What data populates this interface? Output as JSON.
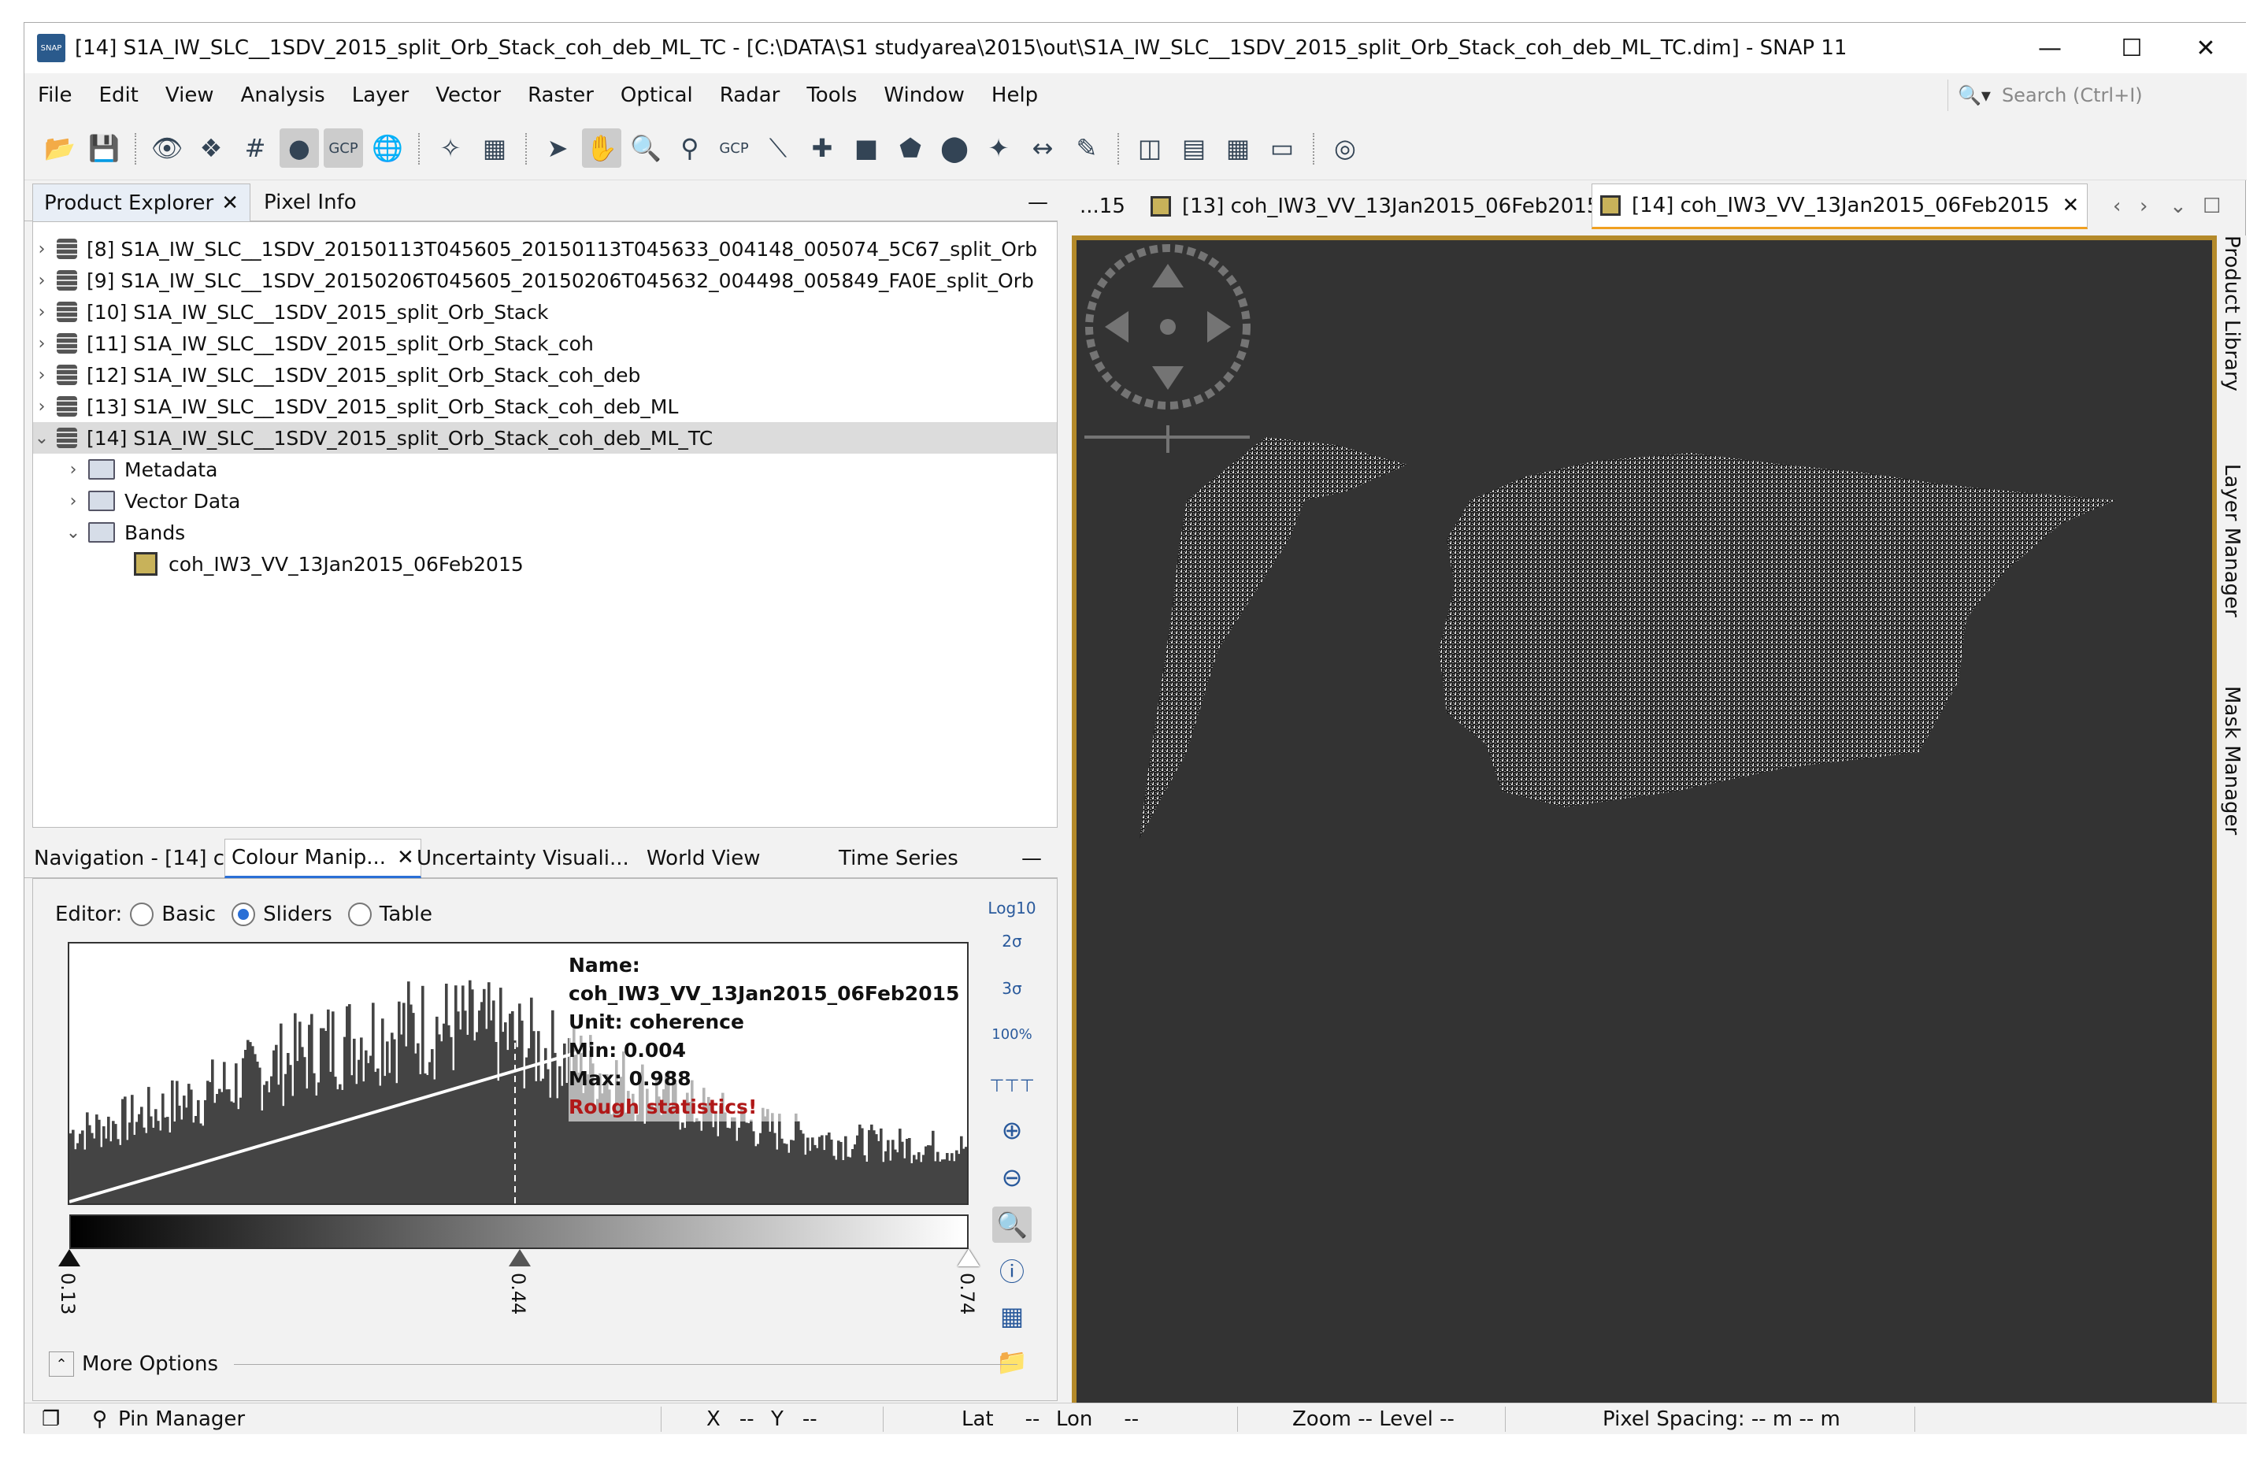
{
  "window": {
    "title": "[14] S1A_IW_SLC__1SDV_2015_split_Orb_Stack_coh_deb_ML_TC - [C:\\DATA\\S1 studyarea\\2015\\out\\S1A_IW_SLC__1SDV_2015_split_Orb_Stack_coh_deb_ML_TC.dim] - SNAP 11",
    "app_icon": "SNAP"
  },
  "menu": [
    "File",
    "Edit",
    "View",
    "Analysis",
    "Layer",
    "Vector",
    "Raster",
    "Optical",
    "Radar",
    "Tools",
    "Window",
    "Help"
  ],
  "search": {
    "placeholder": "Search (Ctrl+I)"
  },
  "left_tabs": {
    "product_explorer": "Product Explorer",
    "pixel_info": "Pixel Info"
  },
  "tree": [
    {
      "label": "[8] S1A_IW_SLC__1SDV_20150113T045605_20150113T045633_004148_005074_5C67_split_Orb"
    },
    {
      "label": "[9] S1A_IW_SLC__1SDV_20150206T045605_20150206T045632_004498_005849_FA0E_split_Orb"
    },
    {
      "label": "[10] S1A_IW_SLC__1SDV_2015_split_Orb_Stack"
    },
    {
      "label": "[11] S1A_IW_SLC__1SDV_2015_split_Orb_Stack_coh"
    },
    {
      "label": "[12] S1A_IW_SLC__1SDV_2015_split_Orb_Stack_coh_deb"
    },
    {
      "label": "[13] S1A_IW_SLC__1SDV_2015_split_Orb_Stack_coh_deb_ML"
    },
    {
      "label": "[14] S1A_IW_SLC__1SDV_2015_split_Orb_Stack_coh_deb_ML_TC"
    }
  ],
  "subtree": {
    "metadata": "Metadata",
    "vector": "Vector Data",
    "bands": "Bands",
    "band": "coh_IW3_VV_13Jan2015_06Feb2015"
  },
  "bottom_tabs": {
    "navigation": "Navigation - [14] c...",
    "colour": "Colour Manip...",
    "uncertainty": "Uncertainty Visuali...",
    "world": "World View",
    "time": "Time Series"
  },
  "editor": {
    "label": "Editor:",
    "basic": "Basic",
    "sliders": "Sliders",
    "table": "Table",
    "selected": "Sliders"
  },
  "stats": {
    "name": "Name: coh_IW3_VV_13Jan2015_06Feb2015",
    "unit": "Unit: coherence",
    "min": "Min: 0.004",
    "max": "Max: 0.988",
    "warning": "Rough statistics!"
  },
  "sliders": {
    "min": "0.13",
    "mid": "0.44",
    "max": "0.74"
  },
  "side_icons": {
    "log": "Log10",
    "s2": "2σ",
    "s3": "3σ",
    "p100": "100%"
  },
  "more_options": "More Options",
  "image_tabs": {
    "t0": "...15",
    "t1": "[13] coh_IW3_VV_13Jan2015_06Feb2015",
    "t2": "[14] coh_IW3_VV_13Jan2015_06Feb2015"
  },
  "right_tabs": {
    "library": "Product Library",
    "layer": "Layer Manager",
    "mask": "Mask Manager"
  },
  "status": {
    "pin": "Pin Manager",
    "x": "X",
    "xval": "--",
    "y": "Y",
    "yval": "--",
    "lat": "Lat",
    "latval": "--",
    "lon": "Lon",
    "lonval": "--",
    "zoom": "Zoom --  Level --",
    "spacing": "Pixel Spacing: -- m -- m"
  },
  "colors": {
    "accent": "#2a6fd6",
    "viewer_bg": "#333333",
    "frame": "#b48a2a",
    "warning": "#b01818"
  }
}
